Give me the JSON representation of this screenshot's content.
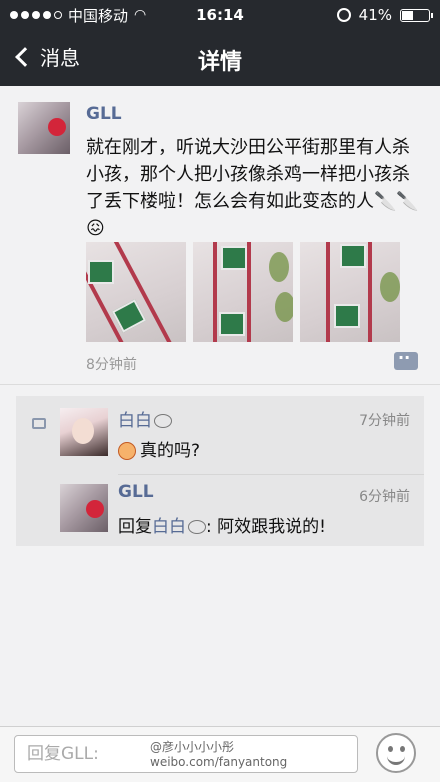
{
  "status_bar": {
    "carrier": "中国移动",
    "time": "16:14",
    "battery": "41%",
    "battery_level": 0.41
  },
  "nav": {
    "back_label": "消息",
    "title": "详情"
  },
  "post": {
    "author": "GLL",
    "text": "就在刚才，听说大沙田公平街那里有人杀小孩，那个人把小孩像杀鸡一样把小孩杀了丢下楼啦！怎么会有如此变态的人🔪🔪😖",
    "photo_count": 3,
    "time": "8分钟前"
  },
  "comments": [
    {
      "name": "白白",
      "time": "7分钟前",
      "text": "真的吗?"
    },
    {
      "name": "GLL",
      "time": "6分钟前",
      "reply_prefix": "回复",
      "reply_to": "白白",
      "text": ": 阿效跟我说的!"
    }
  ],
  "input": {
    "placeholder": "回复GLL:"
  },
  "watermark": {
    "line1": "@彦小小小小彤",
    "line2": "weibo.com/fanyantong"
  },
  "icons": [
    "back-chevron-icon",
    "wifi-icon",
    "lock-rotation-icon",
    "battery-icon",
    "comment-icon",
    "emoji-icon"
  ]
}
